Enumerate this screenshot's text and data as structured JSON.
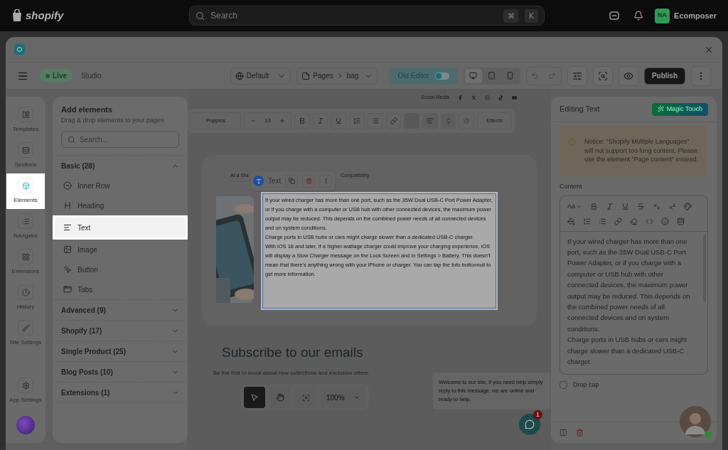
{
  "topbar": {
    "logo": "shopify",
    "search_placeholder": "Search",
    "shortcut_keys": [
      "⌘",
      "K"
    ],
    "avatar_initials": "NA",
    "store": "Ecomposer"
  },
  "toolbar": {
    "status": "Live",
    "mode": "Studio",
    "language": "Default",
    "breadcrumb": [
      "Pages",
      "bag"
    ],
    "old_editor": {
      "label": "Old Editor",
      "on": false
    },
    "devices": [
      {
        "selected": true
      },
      {
        "selected": false
      },
      {
        "selected": false
      }
    ],
    "publish": "Publish"
  },
  "rail": {
    "items": [
      {
        "label": "Templates",
        "selected": false
      },
      {
        "label": "Sections",
        "selected": false
      },
      {
        "label": "Elements",
        "selected": true
      },
      {
        "label": "Navigator",
        "selected": false
      },
      {
        "label": "Extensions",
        "selected": false
      },
      {
        "label": "History",
        "selected": false
      },
      {
        "label": "Site Settings",
        "selected": false
      }
    ],
    "footer": "App Settings"
  },
  "add_elements": {
    "title": "Add elements",
    "subtitle": "Drag & drop elements to your pages",
    "search_placeholder": "Search...",
    "groups": [
      {
        "label": "Basic (28)",
        "expanded": true,
        "items": [
          {
            "label": "Inner Row",
            "selected": false
          },
          {
            "label": "Heading",
            "selected": false
          },
          {
            "label": "Text",
            "selected": true
          },
          {
            "label": "Image",
            "selected": false
          },
          {
            "label": "Button",
            "selected": false
          },
          {
            "label": "Tabs",
            "selected": false
          }
        ]
      },
      {
        "label": "Advanced (9)",
        "expanded": false
      },
      {
        "label": "Shopify (17)",
        "expanded": false
      },
      {
        "label": "Single Product (25)",
        "expanded": false
      },
      {
        "label": "Blog Posts (10)",
        "expanded": false
      },
      {
        "label": "Extensions (1)",
        "expanded": false
      }
    ]
  },
  "canvas": {
    "social_label": "Social Media",
    "font_toolbar": {
      "font": "Poppins",
      "size": "13",
      "effects": "Effects"
    },
    "tabs": [
      {
        "label": "At a Gla",
        "selected": true
      },
      {
        "label": "Compatibility",
        "selected": false
      }
    ],
    "element_toolbar": {
      "label": "Text"
    },
    "text_block": [
      "If your wired charger has more than one port, such as the 35W Dual USB-C Port Power Adapter, or if you charge with a computer or USB hub with other connected devices, the maximum power output may be reduced. This depends on the combined power needs of all connected devices and on system conditions.",
      "Charge ports in USB hubs or cars might charge slower than a dedicated USB-C charger.",
      "With iOS 18 and later, if a higher-wattage charger could improve your charging experience, iOS will display a Slow Charger message on the Lock Screen and in Settings > Battery. This doesn't mean that there's anything wrong with your iPhone or charger. You can tap the Info buttonnull to get more information."
    ],
    "subscribe_title": "Subscribe to our emails",
    "subscribe_text": "Be the first to know about new collections and exclusive offers.",
    "zoom": "100%",
    "chat_message": "Welcome to our site, if you need help simply reply to this message, we are online and ready to help.",
    "chat_badge": "1"
  },
  "right_panel": {
    "title": "Editing Text",
    "magic": "Magic Touch",
    "notice": "Notice: \"Shopify Multiple Languages\" will not support too long content. Please use the element \"Page content\" instead.",
    "content_label": "Content",
    "font_menu": "Aa",
    "content": [
      "If your wired charger has more than one port, such as the 35W Dual USB-C Port Power Adapter, or if you charge with a computer or USB hub with other connected devices, the maximum power output may be reduced. This depends on the combined power needs of all connected devices and on system conditions.",
      "Charge ports in USB hubs or cars might charge slower than a dedicated USB-C charger."
    ],
    "drop_cap": {
      "label": "Drop cap",
      "checked": false
    }
  }
}
